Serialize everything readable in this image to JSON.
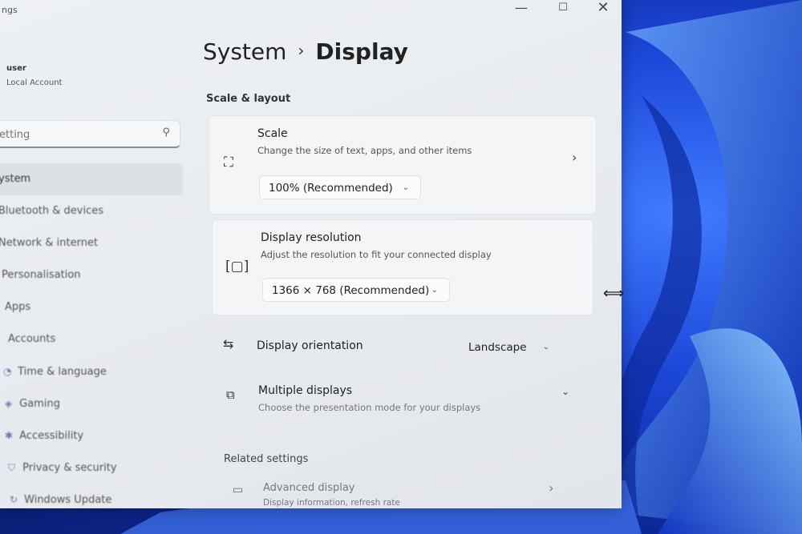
{
  "window": {
    "app_title": "ngs",
    "minimize_glyph": "—",
    "maximize_glyph": "☐",
    "close_glyph": "✕"
  },
  "sidebar": {
    "user_name": "user",
    "account_type": "Local Account",
    "search_placeholder": "etting",
    "nav": [
      {
        "label": "ystem",
        "icon": "system-icon",
        "selected": true
      },
      {
        "label": "Bluetooth & devices",
        "icon": "bluetooth-icon"
      },
      {
        "label": "Network & internet",
        "icon": "network-icon"
      },
      {
        "label": "Personalisation",
        "icon": "brush-icon"
      },
      {
        "label": "Apps",
        "icon": "apps-icon"
      },
      {
        "label": "Accounts",
        "icon": "person-icon"
      },
      {
        "label": "Time & language",
        "icon": "clock-icon"
      },
      {
        "label": "Gaming",
        "icon": "gamepad-icon"
      },
      {
        "label": "Accessibility",
        "icon": "accessibility-icon"
      },
      {
        "label": "Privacy & security",
        "icon": "shield-icon"
      },
      {
        "label": "Windows Update",
        "icon": "update-icon"
      }
    ]
  },
  "main": {
    "breadcrumb_parent": "System",
    "breadcrumb_sep": "›",
    "breadcrumb_current": "Display",
    "section_scale_layout": "Scale & layout",
    "scale": {
      "title": "Scale",
      "subtitle": "Change the size of text, apps, and other items",
      "value": "100% (Recommended)"
    },
    "resolution": {
      "title": "Display resolution",
      "subtitle": "Adjust the resolution to fit your connected display",
      "value": "1366 × 768 (Recommended)"
    },
    "orientation": {
      "title": "Display orientation",
      "value": "Landscape"
    },
    "multiple_displays": {
      "title": "Multiple displays",
      "subtitle": "Choose the presentation mode for your displays"
    },
    "section_related": "Related settings",
    "advanced_display": {
      "title": "Advanced display",
      "subtitle": "Display information, refresh rate"
    }
  },
  "colors": {
    "window_bg": "#eceff2",
    "wallpaper_blue": "#1c47d8"
  }
}
